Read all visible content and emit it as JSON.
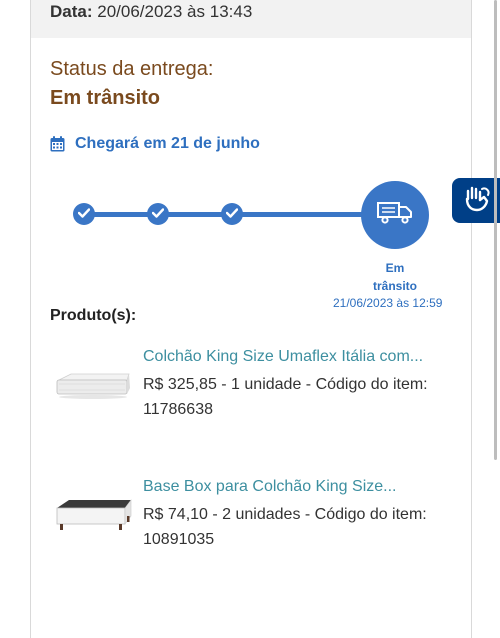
{
  "order": {
    "date_label": "Data:",
    "date_value": "20/06/2023 às 13:43"
  },
  "delivery": {
    "status_label": "Status da entrega:",
    "status_value": "Em trânsito",
    "arrival_text": "Chegará em 21 de junho",
    "current_step_label_line1": "Em",
    "current_step_label_line2": "trânsito",
    "current_step_date": "21/06/2023 às 12:59"
  },
  "products": {
    "title": "Produto(s):",
    "items": [
      {
        "name": "Colchão King Size Umaflex Itália com...",
        "details": "R$ 325,85 - 1 unidade - Código do item: 11786638"
      },
      {
        "name": "Base Box para Colchão King Size...",
        "details": "R$ 74,10 - 2 unidades - Código do item: 10891035"
      }
    ]
  },
  "colors": {
    "accent": "#3a76c6",
    "status_brown": "#7a4a1e",
    "link_teal": "#3d8fa0",
    "accessibility_bg": "#003f87"
  },
  "icons": {
    "calendar": "calendar-icon",
    "check": "check-icon",
    "truck": "truck-icon",
    "sign_language": "sign-language-icon"
  }
}
